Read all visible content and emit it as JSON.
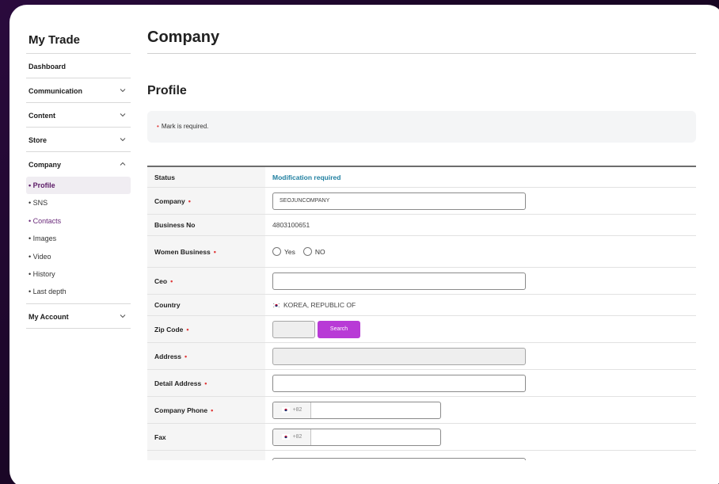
{
  "sidebar": {
    "title": "My Trade",
    "items": [
      {
        "label": "Dashboard"
      },
      {
        "label": "Communication"
      },
      {
        "label": "Content"
      },
      {
        "label": "Store"
      },
      {
        "label": "Company"
      },
      {
        "label": "My Account"
      }
    ],
    "company_sub": [
      {
        "label": "• Profile"
      },
      {
        "label": "• SNS"
      },
      {
        "label": "• Contacts"
      },
      {
        "label": "• Images"
      },
      {
        "label": "• Video"
      },
      {
        "label": "• History"
      },
      {
        "label": "• Last depth"
      }
    ]
  },
  "main": {
    "page_title": "Company",
    "section_title": "Profile",
    "notice_mark": "•",
    "notice_text": "Mark is required.",
    "required_mark": "•",
    "rows": {
      "status": {
        "label": "Status",
        "value": "Modification required"
      },
      "company": {
        "label": "Company",
        "value": "SEOJUNCOMPANY"
      },
      "business_no": {
        "label": "Business No",
        "value": "4803100651"
      },
      "women_business": {
        "label": "Women Business",
        "opt_yes": "Yes",
        "opt_no": "NO"
      },
      "ceo": {
        "label": "Ceo",
        "value": ""
      },
      "country": {
        "label": "Country",
        "value": "KOREA, REPUBLIC OF"
      },
      "zip_code": {
        "label": "Zip Code",
        "value": "",
        "button": "Search"
      },
      "address": {
        "label": "Address",
        "value": ""
      },
      "detail_address": {
        "label": "Detail Address",
        "value": ""
      },
      "company_phone": {
        "label": "Company Phone",
        "code": "+82",
        "value": ""
      },
      "fax": {
        "label": "Fax",
        "code": "+82",
        "value": ""
      }
    }
  },
  "colors": {
    "accent": "#b83ad6",
    "status": "#1f7fa0",
    "required": "#e03a3a"
  }
}
